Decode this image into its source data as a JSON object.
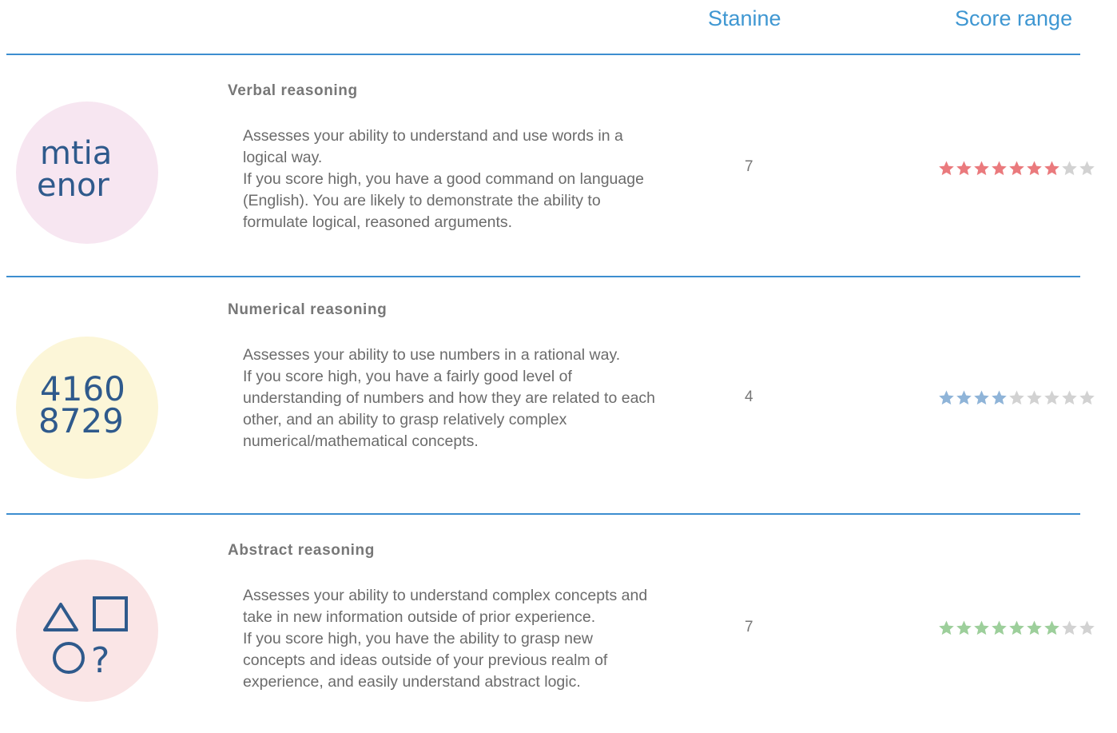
{
  "header": {
    "stanine_label": "Stanine",
    "score_range_label": "Score range"
  },
  "colors": {
    "accent": "#3f97d2",
    "rule": "#3d8ed0",
    "star_empty": "#d2d2d2"
  },
  "rows": [
    {
      "title": "Verbal reasoning",
      "desc1": "Assesses your ability to understand and use words in a logical way.",
      "desc2": "If you score high, you have a good command on language (English). You are likely to demonstrate the ability to formulate logical, reasoned arguments.",
      "stanine": "7",
      "rating": 7,
      "max_rating": 9,
      "star_color": "#ea7a7d",
      "badge_color": "#f7e6f1",
      "icon": "letters-icon",
      "icon_text": [
        "mtia",
        "enor"
      ]
    },
    {
      "title": "Numerical reasoning",
      "desc1": "Assesses your ability to use numbers in a rational way.",
      "desc2": "If you score high, you have a fairly good level of understanding of numbers and how they are related to each other, and an ability to grasp relatively complex numerical/mathematical concepts.",
      "stanine": "4",
      "rating": 4,
      "max_rating": 9,
      "star_color": "#8fb4d8",
      "badge_color": "#fcf6d8",
      "icon": "numbers-icon",
      "icon_text": [
        "4160",
        "8729"
      ]
    },
    {
      "title": "Abstract reasoning",
      "desc1": "Assesses your ability to understand complex concepts and take in new information outside of prior experience.",
      "desc2": "If you score high, you have the ability to grasp new concepts and ideas outside of your previous realm of experience, and easily understand abstract logic.",
      "stanine": "7",
      "rating": 7,
      "max_rating": 9,
      "star_color": "#9dcf9b",
      "badge_color": "#fae5e6",
      "icon": "shapes-icon",
      "icon_text": [
        "?"
      ]
    }
  ]
}
